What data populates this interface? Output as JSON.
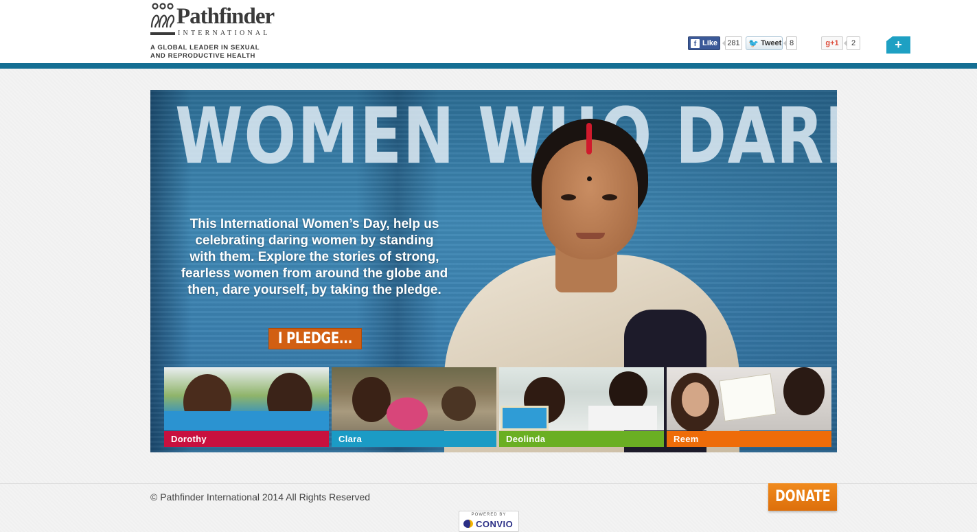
{
  "header": {
    "logo_name": "Pathfinder",
    "logo_subname": "INTERNATIONAL",
    "tagline_line1": "A GLOBAL LEADER IN SEXUAL",
    "tagline_line2": "AND REPRODUCTIVE HEALTH",
    "accent_color": "#146e93"
  },
  "social": {
    "facebook": {
      "icon": "facebook-icon",
      "label": "Like",
      "count": "281"
    },
    "twitter": {
      "icon": "twitter-bird-icon",
      "label": "Tweet",
      "count": "8"
    },
    "google_plus": {
      "icon": "google-plus-icon",
      "label": "g+1",
      "count": "2"
    },
    "share": {
      "icon": "plus-icon",
      "label": "+"
    }
  },
  "hero": {
    "headline": "WOMEN WHO DARE",
    "body": "This International Women’s Day, help us celebrating daring women by standing with them. Explore the stories of strong, fearless women from around the globe and then, dare yourself, by taking the pledge.",
    "pledge_button": "I PLEDGE..."
  },
  "stories": [
    {
      "name": "Dorothy",
      "color": "#c8103e"
    },
    {
      "name": "Clara",
      "color": "#1b9bc5"
    },
    {
      "name": "Deolinda",
      "color": "#6aaf23"
    },
    {
      "name": "Reem",
      "color": "#ee6c09"
    }
  ],
  "footer": {
    "copyright": "© Pathfinder International 2014 All Rights Reserved",
    "donate_button": "DONATE",
    "powered_by": "POWERED BY",
    "convio": "CONVIO"
  }
}
